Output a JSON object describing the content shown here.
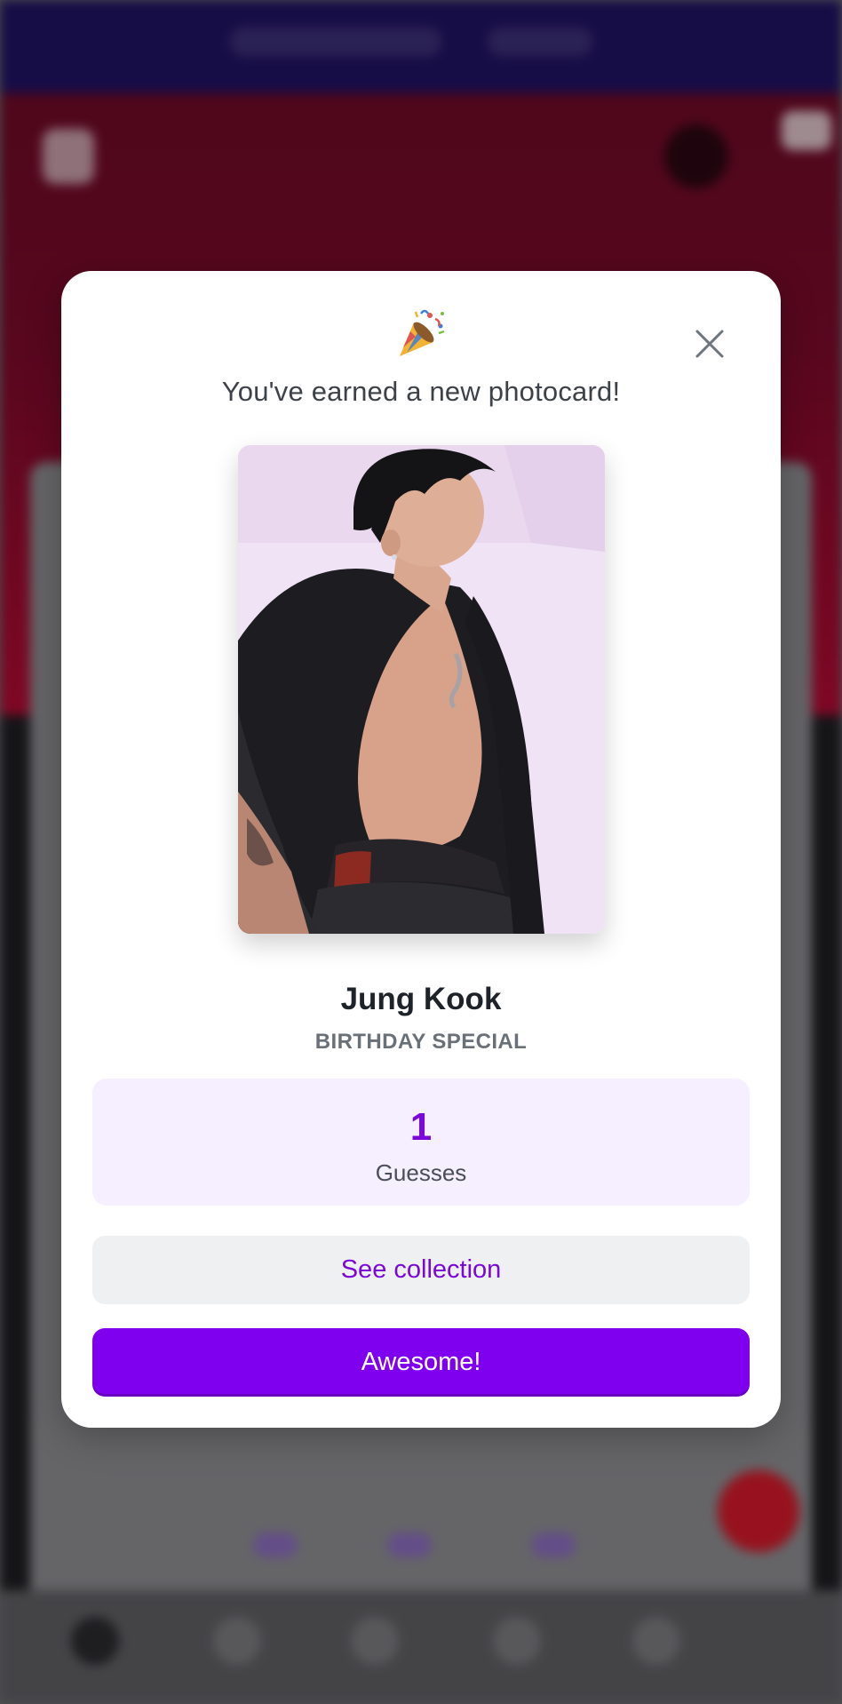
{
  "modal": {
    "icon": "party-popper-icon",
    "headline": "You've earned a new photocard!",
    "close_icon": "close-icon",
    "photocard": {
      "member": "Jung Kook",
      "series": "BIRTHDAY SPECIAL"
    },
    "stat": {
      "value": "1",
      "label": "Guesses"
    },
    "secondary_button": "See collection",
    "primary_button": "Awesome!"
  },
  "colors": {
    "accent": "#7f00ee",
    "accent_text": "#7a08d8",
    "stat_bg": "#f5efff",
    "secondary_bg": "#eff0f2",
    "header_bg": "#201262",
    "hero_bg": "#7a0a2a"
  }
}
